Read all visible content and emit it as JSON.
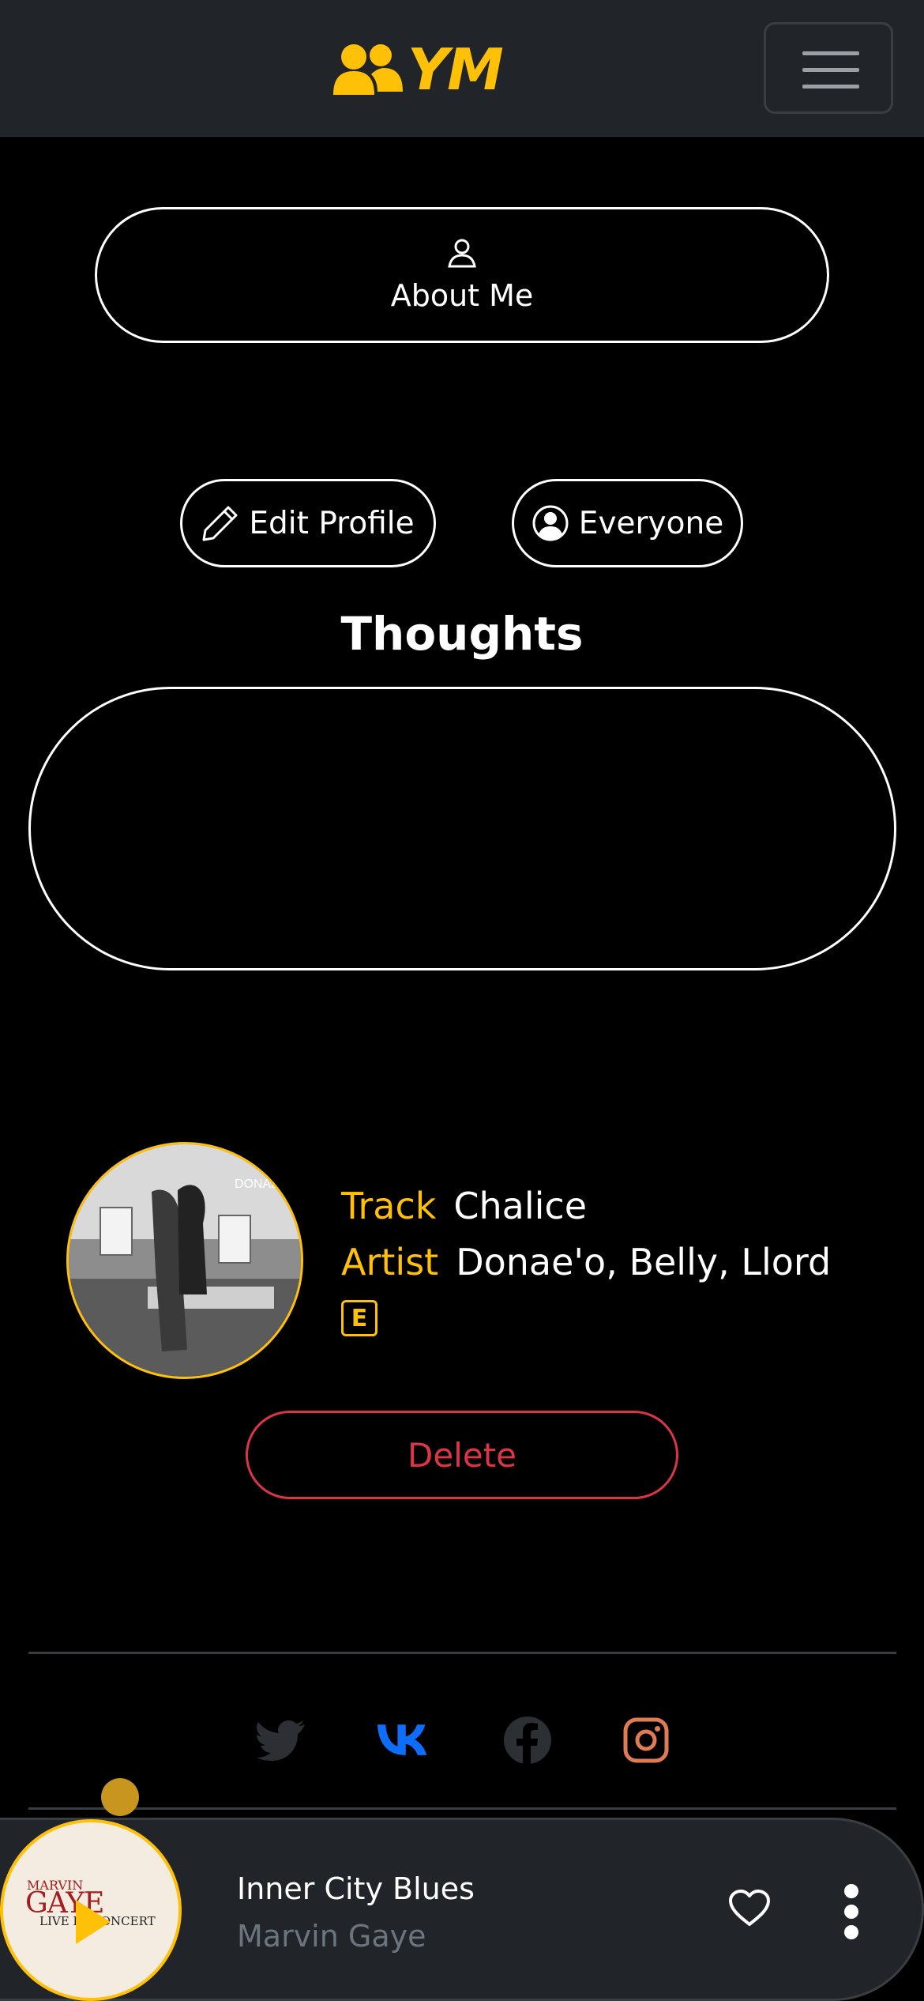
{
  "navbar": {
    "brand": "YM",
    "brand_icon": "users-icon",
    "menu_icon": "hamburger-icon"
  },
  "about": {
    "label": "About Me",
    "icon": "person-icon"
  },
  "profile_actions": {
    "edit_label": "Edit Profile",
    "edit_icon": "pencil-icon",
    "visibility_label": "Everyone",
    "visibility_icon": "person-circle-icon"
  },
  "thoughts": {
    "title": "Thoughts",
    "value": ""
  },
  "track": {
    "track_key": "Track",
    "track_value": "Chalice",
    "artist_key": "Artist",
    "artist_value": "Donae'o, Belly, Llord",
    "explicit_badge": "E",
    "cover_text": "DONAE",
    "delete_label": "Delete"
  },
  "social": [
    "twitter-icon",
    "vk-icon",
    "facebook-icon",
    "instagram-icon"
  ],
  "player": {
    "title": "Inner City Blues",
    "artist": "Marvin Gaye",
    "art_line1": "MARVIN",
    "art_line2": "GAYE",
    "art_line3": "LIVE IN CONCERT",
    "like_icon": "heart-icon",
    "more_icon": "kebab-icon"
  },
  "colors": {
    "accent": "#ffc107",
    "danger": "#dc3545",
    "navbar": "#212529",
    "vk": "#0d6efd",
    "instagram": "#e07b53"
  }
}
